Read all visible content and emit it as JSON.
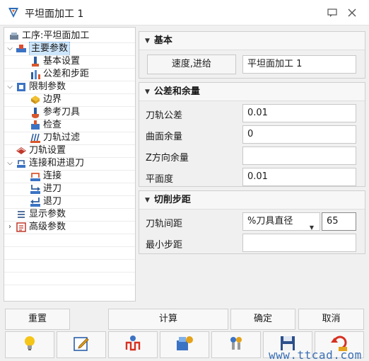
{
  "window": {
    "title": "平坦面加工 1"
  },
  "tree": {
    "root": "工序:平坦面加工",
    "items": [
      "主要参数",
      "基本设置",
      "公差和步距",
      "限制参数",
      "边界",
      "参考刀具",
      "检查",
      "刀轨过滤",
      "刀轨设置",
      "连接和进退刀",
      "连接",
      "进刀",
      "退刀",
      "显示参数",
      "高级参数"
    ]
  },
  "basic": {
    "header": "基本",
    "speed_button": "速度,进给",
    "name_value": "平坦面加工 1"
  },
  "tolerance": {
    "header": "公差和余量",
    "rows": [
      {
        "label": "刀轨公差",
        "value": "0.01"
      },
      {
        "label": "曲面余量",
        "value": "0"
      },
      {
        "label": "Z方向余量",
        "value": ""
      },
      {
        "label": "平面度",
        "value": "0.01"
      }
    ]
  },
  "step": {
    "header": "切削步距",
    "spacing_label": "刀轨间距",
    "spacing_mode": "%刀具直径",
    "spacing_value": "65",
    "min_step_label": "最小步距",
    "min_step_value": ""
  },
  "buttons": {
    "reset": "重置",
    "compute": "计算",
    "ok": "确定",
    "cancel": "取消"
  },
  "watermark": "www.ttcad.com"
}
